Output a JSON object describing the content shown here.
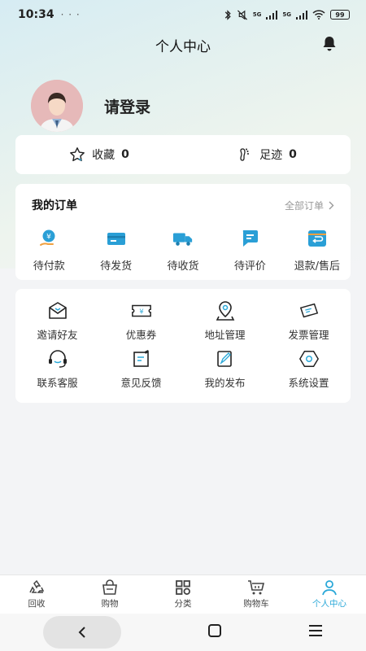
{
  "status_bar": {
    "time": "10:34",
    "dots": "· · ·",
    "battery": "99",
    "net1": "5G",
    "net2": "5G"
  },
  "header": {
    "title": "个人中心"
  },
  "profile": {
    "login_text": "请登录"
  },
  "favorites": [
    {
      "label": "收藏",
      "count": "0"
    },
    {
      "label": "足迹",
      "count": "0"
    }
  ],
  "orders": {
    "title": "我的订单",
    "all_label": "全部订单",
    "items": [
      {
        "label": "待付款",
        "icon": "wallet-yen-icon"
      },
      {
        "label": "待发货",
        "icon": "card-icon"
      },
      {
        "label": "待收货",
        "icon": "truck-icon"
      },
      {
        "label": "待评价",
        "icon": "comment-icon"
      },
      {
        "label": "退款/售后",
        "icon": "refund-icon"
      }
    ]
  },
  "services": [
    {
      "label": "邀请好友",
      "icon": "invite-envelope-icon"
    },
    {
      "label": "优惠券",
      "icon": "coupon-icon"
    },
    {
      "label": "地址管理",
      "icon": "location-pin-icon"
    },
    {
      "label": "发票管理",
      "icon": "invoice-icon"
    },
    {
      "label": "联系客服",
      "icon": "headset-icon"
    },
    {
      "label": "意见反馈",
      "icon": "feedback-icon"
    },
    {
      "label": "我的发布",
      "icon": "publish-icon"
    },
    {
      "label": "系统设置",
      "icon": "settings-hexagon-icon"
    }
  ],
  "tabbar": [
    {
      "label": "回收",
      "icon": "recycle-icon"
    },
    {
      "label": "购物",
      "icon": "shopping-bag-icon"
    },
    {
      "label": "分类",
      "icon": "grid-icon"
    },
    {
      "label": "购物车",
      "icon": "cart-icon"
    },
    {
      "label": "个人中心",
      "icon": "person-icon",
      "active": true
    }
  ],
  "colors": {
    "accent": "#2aa8d8",
    "order_icon": "#2a9fd6",
    "text": "#222222"
  }
}
